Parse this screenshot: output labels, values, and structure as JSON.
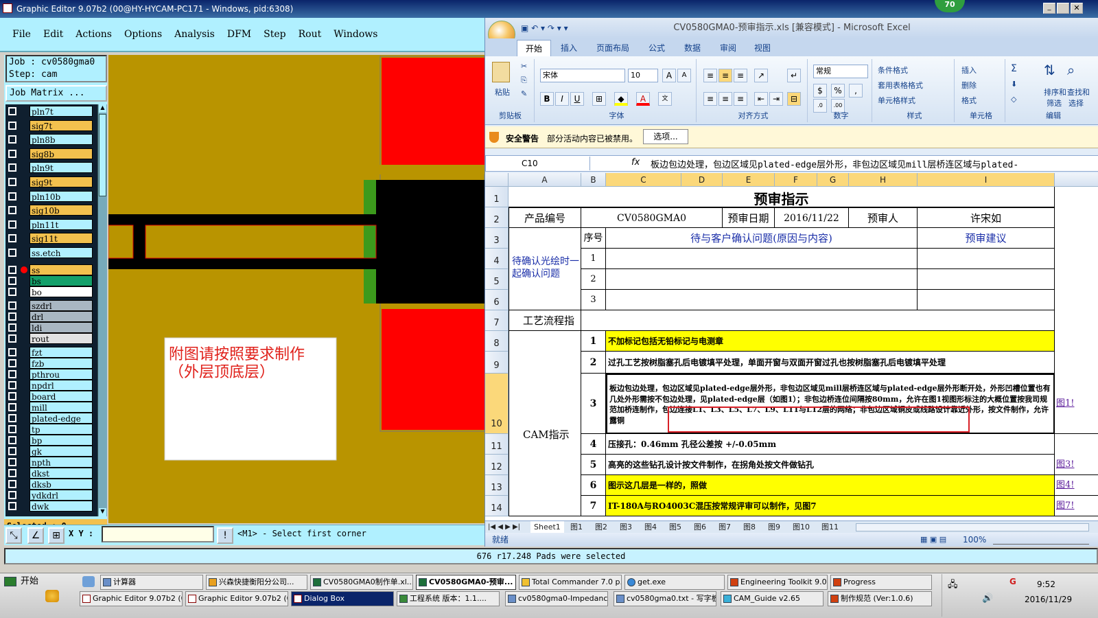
{
  "ge": {
    "title": "Graphic Editor 9.07b2 (00@HY-HYCAM-PC171 - Windows, pid:6308)",
    "menu": [
      "File",
      "Edit",
      "Actions",
      "Options",
      "Analysis",
      "DFM",
      "Step",
      "Rout",
      "Windows"
    ],
    "job": "Job  : cv0580gma0",
    "step": "Step: cam",
    "job_matrix": "Job Matrix ...",
    "layers": [
      {
        "name": "pln7t",
        "color": "#b0f0ff"
      },
      {
        "name": "sig7t",
        "color": "#f3c14e"
      },
      {
        "name": "pln8b",
        "color": "#b0f0ff"
      },
      {
        "name": "sig8b",
        "color": "#f3c14e"
      },
      {
        "name": "pln9t",
        "color": "#b0f0ff"
      },
      {
        "name": "sig9t",
        "color": "#f3c14e"
      },
      {
        "name": "pln10b",
        "color": "#b0f0ff"
      },
      {
        "name": "sig10b",
        "color": "#f3c14e"
      },
      {
        "name": "pln11t",
        "color": "#b0f0ff"
      },
      {
        "name": "sig11t",
        "color": "#f3c14e"
      },
      {
        "name": "ss.etch",
        "color": "#b0f0ff"
      },
      {
        "name": "ss",
        "color": "#f3c14e"
      },
      {
        "name": "bs",
        "color": "#14a06a"
      },
      {
        "name": "bo",
        "color": "#ffffff"
      },
      {
        "name": "szdrl",
        "color": "#a9b7c2"
      },
      {
        "name": "drl",
        "color": "#a9b7c2"
      },
      {
        "name": "ldi",
        "color": "#a9b7c2"
      },
      {
        "name": "rout",
        "color": "#e2e2e2"
      },
      {
        "name": "fzt",
        "color": "#b0f0ff"
      },
      {
        "name": "fzb",
        "color": "#b0f0ff"
      },
      {
        "name": "pthrou",
        "color": "#b0f0ff"
      },
      {
        "name": "npdrl",
        "color": "#b0f0ff"
      },
      {
        "name": "board",
        "color": "#b0f0ff"
      },
      {
        "name": "mill",
        "color": "#b0f0ff"
      },
      {
        "name": "plated-edge",
        "color": "#b0f0ff"
      },
      {
        "name": "tp",
        "color": "#b0f0ff"
      },
      {
        "name": "bp",
        "color": "#b0f0ff"
      },
      {
        "name": "gk",
        "color": "#b0f0ff"
      },
      {
        "name": "npth",
        "color": "#b0f0ff"
      },
      {
        "name": "dkst",
        "color": "#b0f0ff"
      },
      {
        "name": "dksb",
        "color": "#b0f0ff"
      },
      {
        "name": "ydkdrl",
        "color": "#b0f0ff"
      },
      {
        "name": "dwk",
        "color": "#b0f0ff"
      }
    ],
    "selected": "Selected : 0",
    "note_line1": "附图请按照要求制作",
    "note_line2": "（外层顶底层）",
    "xy_label": "X Y :",
    "prompt": "<M1> - Select first corner",
    "status": "676 r17.248 Pads were selected"
  },
  "excel": {
    "title": "CV0580GMA0-预审指示.xls  [兼容模式] - Microsoft Excel",
    "tabs": [
      "开始",
      "插入",
      "页面布局",
      "公式",
      "数据",
      "审阅",
      "视图"
    ],
    "ribbon": {
      "paste": "粘贴",
      "clipboard": "剪贴板",
      "font_name": "宋体",
      "font_size": "10",
      "font_group": "字体",
      "align_group": "对齐方式",
      "number_format": "常规",
      "number_group": "数字",
      "cond_format": "条件格式",
      "table_format": "套用表格格式",
      "cell_style": "单元格样式",
      "style_group": "样式",
      "insert": "插入",
      "delete": "删除",
      "format": "格式",
      "cells_group": "单元格",
      "sort": "排序和",
      "filter": "筛选",
      "find": "查找和",
      "select": "选择",
      "edit_group": "编辑"
    },
    "security_title": "安全警告",
    "security_text": "部分活动内容已被禁用。",
    "options_btn": "选项...",
    "name_box": "C10",
    "formula": "板边包边处理，包边区域见plated-edge层外形，非包边区域见mill层桥连区域与plated-",
    "columns": [
      "A",
      "B",
      "C",
      "D",
      "E",
      "F",
      "G",
      "H",
      "I"
    ],
    "rows": [
      "1",
      "2",
      "3",
      "4",
      "5",
      "6",
      "7",
      "8",
      "9",
      "10",
      "11",
      "12",
      "13",
      "14"
    ],
    "cells": {
      "title": "预审指示",
      "prod_no_label": "产品编号",
      "prod_no": "CV0580GMA0",
      "date_label": "预审日期",
      "date": "2016/11/22",
      "reviewer_label": "预审人",
      "reviewer": "许宋如",
      "seq": "序号",
      "confirm_header": "待与客户确认问题(原因与内容)",
      "advice_header": "预审建议",
      "confirm_label": "待确认光绘时一起确认问题",
      "n1": "1",
      "n2": "2",
      "n3": "3",
      "process_label": "工艺流程指示",
      "p1": "1",
      "p1_text": "不加标记包括无铅标记与电测章",
      "p2": "2",
      "p2_text": "过孔工艺按树脂塞孔后电镀填平处理，单面开窗与双面开窗过孔也按树脂塞孔后电镀填平处理",
      "cam_label": "CAM指示",
      "c3": "3",
      "c3_text": "板边包边处理，包边区域见plated-edge层外形，非包边区域见mill层桥连区域与plated-edge层外形断开处，外形凹槽位置也有几处外形需按不包边处理，见plated-edge层（如图1）；非包边桥连位间隔按80mm，允许在图1视图形标注的大概位置按我司规范加桥连制作，包边连接L1、L3、L5、L7、L9、L11与L12层的网络；非包边区域铜皮或线路设计靠近外形，按文件制作，允许露铜",
      "c4": "4",
      "c4_text": "压接孔：0.46mm 孔径公差按 +/-0.05mm",
      "c5": "5",
      "c5_text": "高亮的这些钻孔设计按文件制作，在拐角处按文件做钻孔",
      "c6": "6",
      "c6_text": "图示这几层是一样的，照做",
      "c7": "7",
      "c7_text": "IT-180A与RO4003C混压按常规评审可以制作，见图7",
      "link1": "图1!",
      "link3": "图3!",
      "link4": "图4!",
      "link7": "图7!"
    },
    "sheet_tabs": [
      "Sheet1",
      "图1",
      "图2",
      "图3",
      "图4",
      "图5",
      "图6",
      "图7",
      "图8",
      "图9",
      "图10",
      "图11"
    ],
    "status_ready": "就绪",
    "zoom": "100%"
  },
  "taskbar": {
    "start": "开始",
    "row1": [
      "计算器",
      "兴森快捷衡阳分公司...",
      "CV0580GMA0制作单.xl...",
      "CV0580GMA0-预审...",
      "Total Commander 7.0 p...",
      "get.exe",
      "Engineering Toolkit 9.0...",
      "Progress"
    ],
    "row2": [
      "Graphic Editor 9.07b2 (0...",
      "Graphic Editor 9.07b2 (0...",
      "Dialog Box",
      "工程系统  版本：1.1....",
      "cv0580gma0-Impedance...",
      "cv0580gma0.txt - 写字板",
      "CAM_Guide v2.65",
      "制作规范 (Ver:1.0.6)"
    ],
    "time": "9:52",
    "date": "2016/11/29",
    "badge": "70"
  }
}
